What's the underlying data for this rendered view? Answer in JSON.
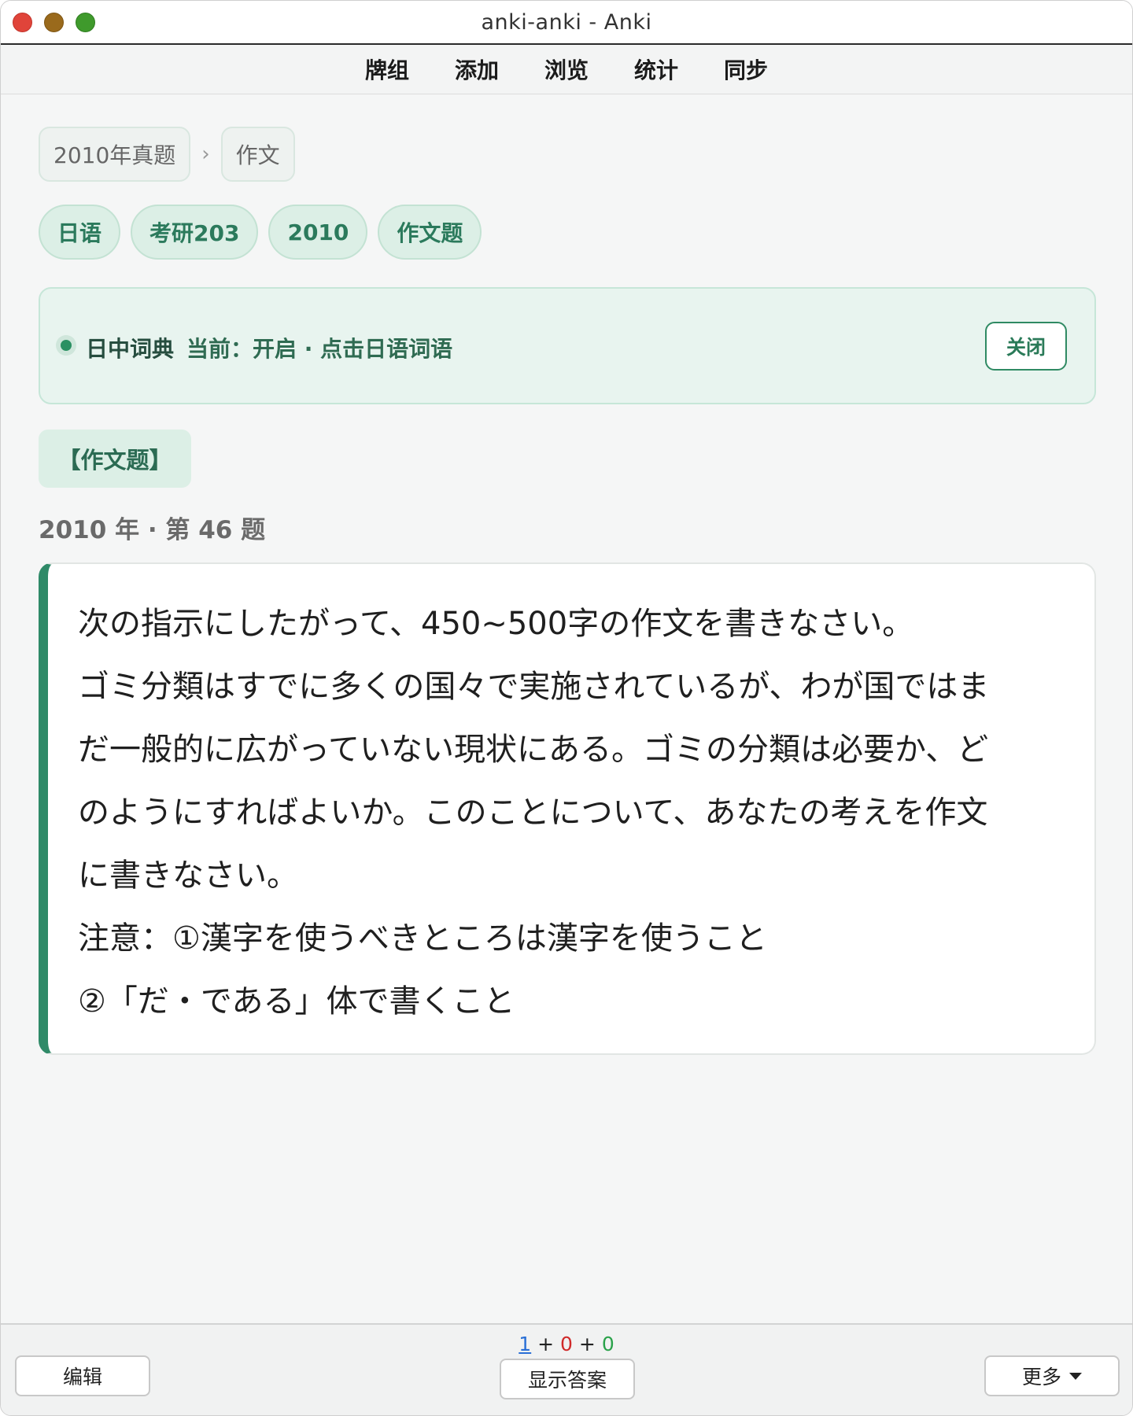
{
  "window": {
    "title": "anki-anki - Anki"
  },
  "toolbar": {
    "items": [
      "牌组",
      "添加",
      "浏览",
      "统计",
      "同步"
    ]
  },
  "breadcrumb": {
    "items": [
      "2010年真题",
      "作文"
    ],
    "separator": "›"
  },
  "tags": [
    "日语",
    "考研203",
    "2010",
    "作文题"
  ],
  "dictionary": {
    "label": "日中词典",
    "status": "当前：开启 · 点击日语词语",
    "close_label": "关闭",
    "indicator_color": "#2a9062"
  },
  "question": {
    "type_label": "【作文题】",
    "meta": "2010 年 · 第 46 题",
    "lines": [
      "次の指示にしたがって、450~500字の作文を書きなさい。",
      "ゴミ分類はすでに多くの国々で実施されているが、わが国ではま",
      "だ一般的に広がっていない現状にある。ゴミの分類は必要か、ど",
      "のようにすればよいか。このことについて、あなたの考えを作文",
      "に書きなさい。",
      "注意：①漢字を使うべきところは漢字を使うこと",
      "②「だ・である」体で書くこと"
    ],
    "accent_color": "#2f8a68"
  },
  "bottom": {
    "counts": {
      "new": "1",
      "learn": "0",
      "review": "0",
      "plus": "+"
    },
    "edit_label": "编辑",
    "show_answer_label": "显示答案",
    "more_label": "更多"
  }
}
